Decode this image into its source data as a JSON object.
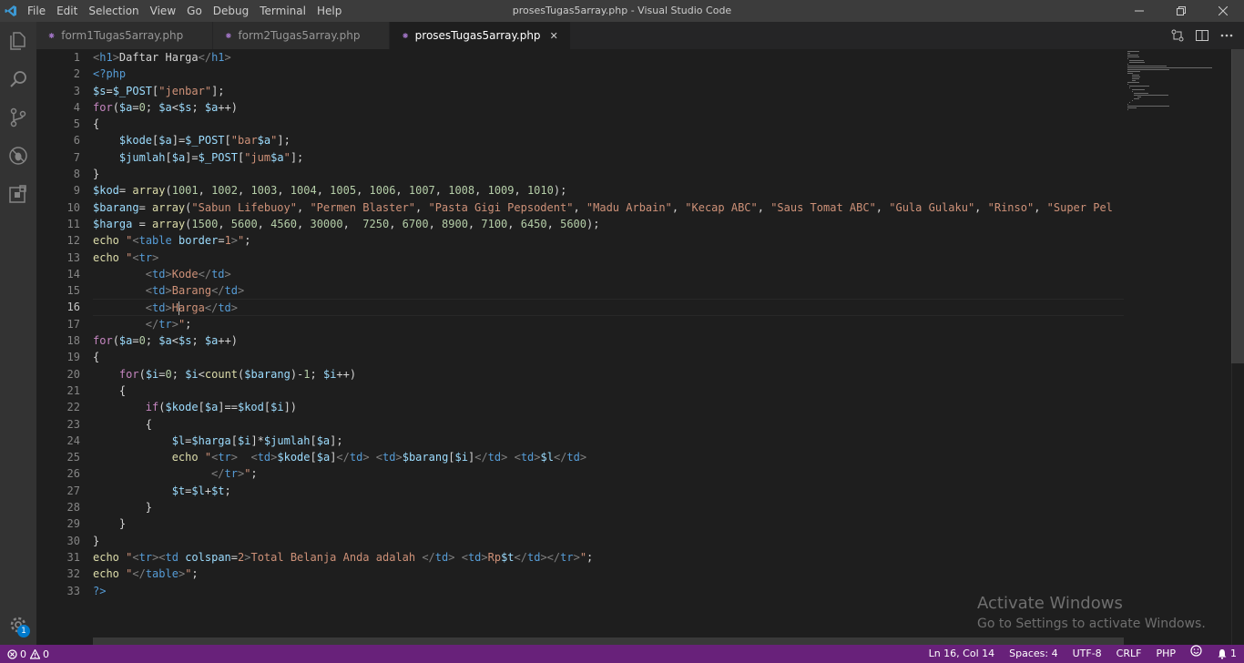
{
  "window": {
    "title": "prosesTugas5array.php - Visual Studio Code"
  },
  "menu": [
    "File",
    "Edit",
    "Selection",
    "View",
    "Go",
    "Debug",
    "Terminal",
    "Help"
  ],
  "tabs": [
    {
      "label": "form1Tugas5array.php",
      "active": false
    },
    {
      "label": "form2Tugas5array.php",
      "active": false
    },
    {
      "label": "prosesTugas5array.php",
      "active": true
    }
  ],
  "activity": {
    "settings_badge": "1"
  },
  "editor": {
    "current_line": 16,
    "line_numbers": [
      "1",
      "2",
      "3",
      "4",
      "5",
      "6",
      "7",
      "8",
      "9",
      "10",
      "11",
      "12",
      "13",
      "14",
      "15",
      "16",
      "17",
      "18",
      "19",
      "20",
      "21",
      "22",
      "23",
      "24",
      "25",
      "26",
      "27",
      "28",
      "29",
      "30",
      "31",
      "32",
      "33"
    ]
  },
  "watermark": {
    "title": "Activate Windows",
    "subtitle": "Go to Settings to activate Windows."
  },
  "status": {
    "errors": "0",
    "warnings": "0",
    "position": "Ln 16, Col 14",
    "spaces": "Spaces: 4",
    "encoding": "UTF-8",
    "eol": "CRLF",
    "language": "PHP",
    "notifications": "1"
  },
  "colors": {
    "status_bar": "#68217a",
    "accent": "#007acc"
  }
}
